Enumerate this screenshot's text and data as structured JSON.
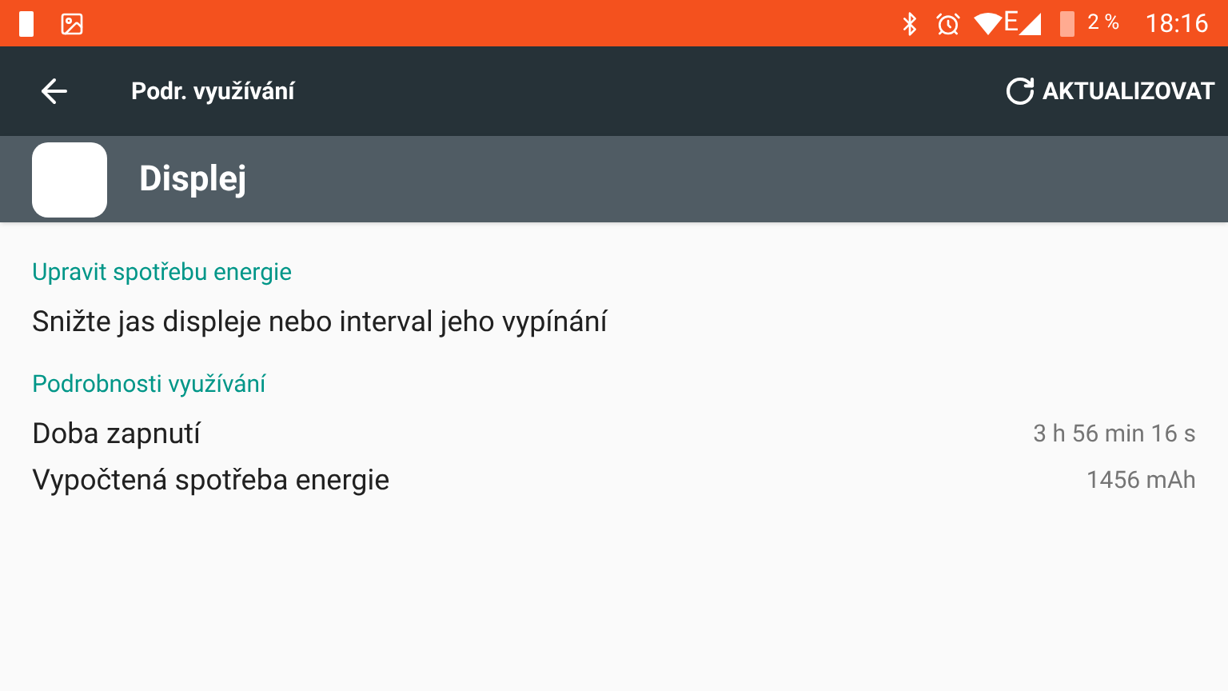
{
  "status_bar": {
    "network": "E",
    "battery": "2 %",
    "time": "18:16"
  },
  "app_bar": {
    "title": "Podr. využívání",
    "action": "AKTUALIZOVAT"
  },
  "header": {
    "title": "Displej"
  },
  "sections": [
    {
      "title": "Upravit spotřebu energie",
      "items": [
        {
          "kind": "action",
          "label": "Snižte jas displeje nebo interval jeho vypínání"
        }
      ]
    },
    {
      "title": "Podrobnosti využívání",
      "items": [
        {
          "kind": "stat",
          "label": "Doba zapnutí",
          "value": "3 h 56 min 16 s"
        },
        {
          "kind": "stat",
          "label": "Vypočtená spotřeba energie",
          "value": "1456 mAh"
        }
      ]
    }
  ]
}
